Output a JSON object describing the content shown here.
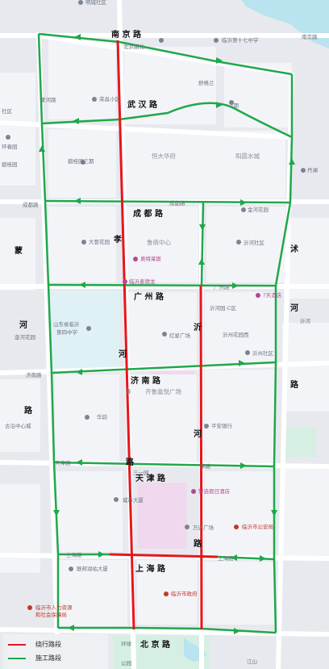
{
  "colors": {
    "detour": "#e8151b",
    "construction": "#1fa84a",
    "block": "#f3f4f8",
    "road": "#ffffff",
    "water": "#b9e3ee",
    "green": "#d6efe3",
    "plaza": "#f0d9ef",
    "land": "#e7e9ee"
  },
  "roads": {
    "nanjing": "南 京 路",
    "wuhan": "武 汉 路",
    "chengdu": "成 都 路",
    "guangzhou": "广 州 路",
    "jinan": "济 南 路",
    "tianjin": "天 津 路",
    "shanghai": "上 海 路",
    "beijing": "北 京 路",
    "xiaohe": [
      "孝",
      "河",
      "路"
    ],
    "yihe": [
      "沂",
      "河",
      "路"
    ],
    "shuhe": [
      "沭",
      "河",
      "路"
    ],
    "menghe": [
      "蒙",
      "河",
      "路"
    ]
  },
  "pois": [
    {
      "id": "p1",
      "label": "明城社区",
      "color": "gray"
    },
    {
      "id": "p2",
      "label": "北京路北",
      "color": "gray"
    },
    {
      "id": "p3",
      "label": "临沂第十七中学",
      "color": "gray"
    },
    {
      "id": "p4",
      "label": "南京路",
      "color": "gray"
    },
    {
      "id": "p5",
      "label": "蒙河路",
      "color": "gray"
    },
    {
      "id": "p6",
      "label": "舒格兰",
      "color": "gray"
    },
    {
      "id": "p7",
      "label": "荣昌小区",
      "color": "gray"
    },
    {
      "id": "p8",
      "label": "1期",
      "color": "gray"
    },
    {
      "id": "p9",
      "label": "社区",
      "color": "gray"
    },
    {
      "id": "p10",
      "label": "环春园",
      "color": "gray"
    },
    {
      "id": "p11",
      "label": "碧桂园",
      "color": "gray"
    },
    {
      "id": "p12",
      "label": "碧桂园三期",
      "color": "gray"
    },
    {
      "id": "p13",
      "label": "恒大华府",
      "color": "gray"
    },
    {
      "id": "p14",
      "label": "阳晨水城",
      "color": "gray"
    },
    {
      "id": "p15",
      "label": "丹澜",
      "color": "gray"
    },
    {
      "id": "p16",
      "label": "成都路",
      "color": "gray"
    },
    {
      "id": "p17",
      "label": "成都路",
      "color": "gray"
    },
    {
      "id": "p18",
      "label": "金河花园",
      "color": "gray"
    },
    {
      "id": "p19",
      "label": "大管花园",
      "color": "gray"
    },
    {
      "id": "p20",
      "label": "鲁商中心",
      "color": "gray"
    },
    {
      "id": "p21",
      "label": "沂河社区",
      "color": "gray"
    },
    {
      "id": "p22",
      "label": "奥特莱斯",
      "color": "pink"
    },
    {
      "id": "p23",
      "label": "临沂麦德龙",
      "color": "pink"
    },
    {
      "id": "p24",
      "label": "广州路",
      "color": "gray"
    },
    {
      "id": "p25",
      "label": "沂河园·C区",
      "color": "gray"
    },
    {
      "id": "p26",
      "label": "7天酒店",
      "color": "pink"
    },
    {
      "id": "p27",
      "label": "山东省临沂",
      "color": "gray"
    },
    {
      "id": "p28",
      "label": "第四中学",
      "color": "gray"
    },
    {
      "id": "p29",
      "label": "金河花园",
      "color": "gray"
    },
    {
      "id": "p30",
      "label": "红星广场",
      "color": "gray"
    },
    {
      "id": "p31",
      "label": "沂州花园西",
      "color": "gray"
    },
    {
      "id": "p32",
      "label": "沂州社区",
      "color": "gray"
    },
    {
      "id": "p33",
      "label": "沂河",
      "color": "gray"
    },
    {
      "id": "p34",
      "label": "济南路",
      "color": "gray"
    },
    {
      "id": "p35",
      "label": "齐鲁嘉悦广场",
      "color": "gray"
    },
    {
      "id": "p36",
      "label": "鲁",
      "color": "gray"
    },
    {
      "id": "p37",
      "label": "华韵",
      "color": "gray"
    },
    {
      "id": "p38",
      "label": "平安银行",
      "color": "gray"
    },
    {
      "id": "p39",
      "label": "古沿中心城",
      "color": "gray"
    },
    {
      "id": "p40",
      "label": "天津路",
      "color": "gray"
    },
    {
      "id": "p41",
      "label": "津路",
      "color": "gray"
    },
    {
      "id": "p42",
      "label": "三一园",
      "color": "gray"
    },
    {
      "id": "p43",
      "label": "城市大厦",
      "color": "gray"
    },
    {
      "id": "p44",
      "label": "智选假日酒店",
      "color": "pink"
    },
    {
      "id": "p45",
      "label": "万达广场",
      "color": "gray"
    },
    {
      "id": "p46",
      "label": "临沂市公安局",
      "color": "red"
    },
    {
      "id": "p47",
      "label": "上海路",
      "color": "gray"
    },
    {
      "id": "p48",
      "label": "上海路",
      "color": "gray"
    },
    {
      "id": "p49",
      "label": "联邦润佑大厦",
      "color": "gray"
    },
    {
      "id": "p50",
      "label": "临沂市政府",
      "color": "red"
    },
    {
      "id": "p51",
      "label": "临沂市人力资源",
      "color": "red"
    },
    {
      "id": "p52",
      "label": "和社会保障局",
      "color": "red"
    },
    {
      "id": "p53",
      "label": "环球",
      "color": "gray"
    },
    {
      "id": "p54",
      "label": "公园",
      "color": "gray"
    },
    {
      "id": "p55",
      "label": "江山",
      "color": "gray"
    }
  ],
  "legend": [
    {
      "label": "绕行路段",
      "color": "#e8151b"
    },
    {
      "label": "施工路段",
      "color": "#1fa84a"
    }
  ]
}
